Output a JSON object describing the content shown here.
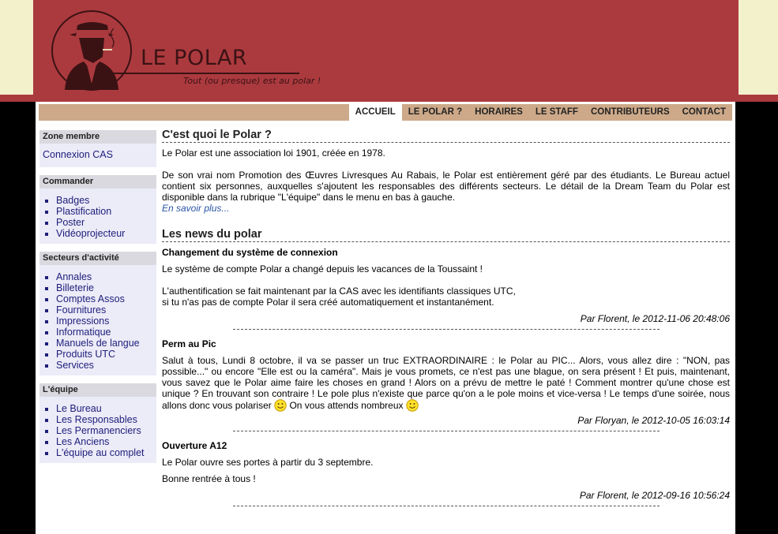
{
  "header": {
    "title": "LE POLAR",
    "tagline": "Tout (ou presque) est au polar !"
  },
  "nav": {
    "items": [
      {
        "label": "ACCUEIL",
        "active": true
      },
      {
        "label": "LE POLAR ?",
        "active": false
      },
      {
        "label": "HORAIRES",
        "active": false
      },
      {
        "label": "LE STAFF",
        "active": false
      },
      {
        "label": "CONTRIBUTEURS",
        "active": false
      },
      {
        "label": "CONTACT",
        "active": false
      }
    ]
  },
  "sidebar": {
    "zone": {
      "title": "Zone membre",
      "link": "Connexion CAS"
    },
    "commander": {
      "title": "Commander",
      "items": [
        "Badges",
        "Plastification",
        "Poster",
        "Vidéoprojecteur"
      ]
    },
    "secteurs": {
      "title": "Secteurs d'activité",
      "items": [
        "Annales",
        "Billeterie",
        "Comptes Assos",
        "Fournitures",
        "Impressions",
        "Informatique",
        "Manuels de langue",
        "Produits UTC",
        "Services"
      ]
    },
    "equipe": {
      "title": "L'équipe",
      "items": [
        "Le Bureau",
        "Les Responsables",
        "Les Permanenciers",
        "Les Anciens",
        "L'équipe au complet"
      ]
    }
  },
  "about": {
    "title": "C'est quoi le Polar ?",
    "p1": "Le Polar est une association loi 1901, créée en 1978.",
    "p2": "De son vrai nom Promotion des Œuvres Livresques Au Rabais, le Polar est entièrement géré par des étudiants. Le Bureau actuel contient six personnes, auxquelles s'ajoutent les responsables des différents secteurs. Le détail de la Dream Team du Polar est disponible dans la rubrique \"L'équipe\" dans le menu en bas à gauche.",
    "more": "En savoir plus..."
  },
  "news": {
    "title": "Les news du polar",
    "items": [
      {
        "title": "Changement du système de connexion",
        "p1": "Le système de compte Polar a changé depuis les vacances de la Toussaint !",
        "p2a": "L'authentification se fait maintenant par la CAS avec les identifiants classiques UTC,",
        "p2b": "si tu n'as pas de compte Polar il sera créé automatiquement et instantanément.",
        "meta": "Par Florent, le 2012-11-06 20:48:06"
      },
      {
        "title": "Perm au Pic",
        "p1": "Salut à tous, Lundi 8 octobre, il va se passer un truc EXTRAORDINAIRE : le Polar au PIC... Alors, vous allez dire : \"NON, pas possible...\" ou encore \"Elle est ou la caméra\". Mais je vous promets, ce n'est pas une blague, on sera présent ! Et puis, maintenant, vous savez que le Polar aime faire les choses en grand ! Alors on a prévu de mettre le paté ! Comment montrer qu'une chose est unique ? En trouvant son contraire ! Le pole plus n'existe que parce qu'on a le pole moins et vice-versa ! Le temps d'une soirée, nous allons donc vous polariser",
        "p1b": "On vous attends nombreux",
        "meta": "Par Floryan, le 2012-10-05 16:03:14"
      },
      {
        "title": "Ouverture A12",
        "p1": "Le Polar ouvre ses portes à partir du 3 septembre.",
        "p2": "Bonne rentrée à tous !",
        "meta": "Par Florent, le 2012-09-16 10:56:24"
      }
    ]
  },
  "colors": {
    "header": "#ab3a3e",
    "cream": "#f3f0cc",
    "nav": "#cda989",
    "sidebar_block": "#ecebf8",
    "link": "#1d1e7a"
  }
}
